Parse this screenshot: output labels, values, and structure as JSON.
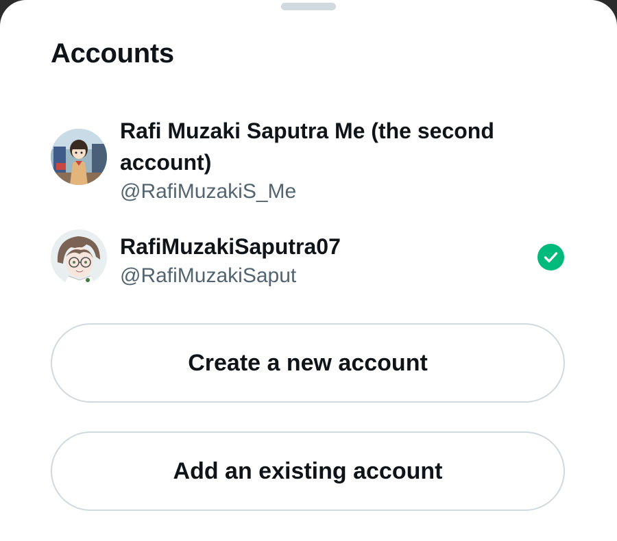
{
  "sheet": {
    "title": "Accounts"
  },
  "accounts": [
    {
      "name": "Rafi Muzaki Saputra Me (the second account)",
      "handle": "@RafiMuzakiS_Me",
      "avatar_icon": "anime-girl-avatar",
      "selected": false
    },
    {
      "name": "RafiMuzakiSaputra07",
      "handle": "@RafiMuzakiSaput",
      "avatar_icon": "anime-boy-glasses-avatar",
      "selected": true,
      "selected_icon": "check-circle-icon"
    }
  ],
  "buttons": {
    "create_label": "Create a new account",
    "add_label": "Add an existing account"
  },
  "colors": {
    "text_primary": "#0f1419",
    "text_secondary": "#536471",
    "border": "#cfd9de",
    "check_green": "#00ba7c",
    "background": "#ffffff"
  }
}
